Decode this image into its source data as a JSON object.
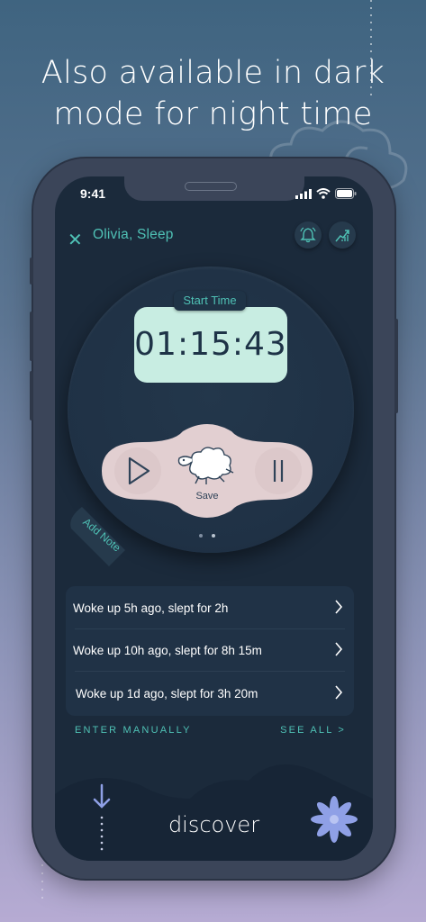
{
  "marketing": {
    "headline_line1": "Also available in dark",
    "headline_line2": "mode for night time"
  },
  "status_bar": {
    "time": "9:41"
  },
  "header": {
    "title": "Olivia, Sleep"
  },
  "timer": {
    "label": "Start Time",
    "value": "01:15:43",
    "save_label": "Save"
  },
  "add_note_label": "Add Note",
  "pager": {
    "pages": 2
  },
  "history": [
    {
      "text": "Woke up 5h ago, slept for 2h"
    },
    {
      "text": "Woke up 10h ago, slept for 8h 15m"
    },
    {
      "text": "Woke up 1d ago, slept for 3h 20m"
    }
  ],
  "actions": {
    "enter_manually": "ENTER MANUALLY",
    "see_all": "SEE ALL >"
  },
  "bottom": {
    "discover_label": "discover"
  },
  "colors": {
    "accent": "#4fc1b5",
    "screen_bg": "#1b2a3b",
    "timer_bg": "#c8ede2",
    "controls_bg": "#e2cfd1",
    "flower": "#8fa0e6"
  }
}
